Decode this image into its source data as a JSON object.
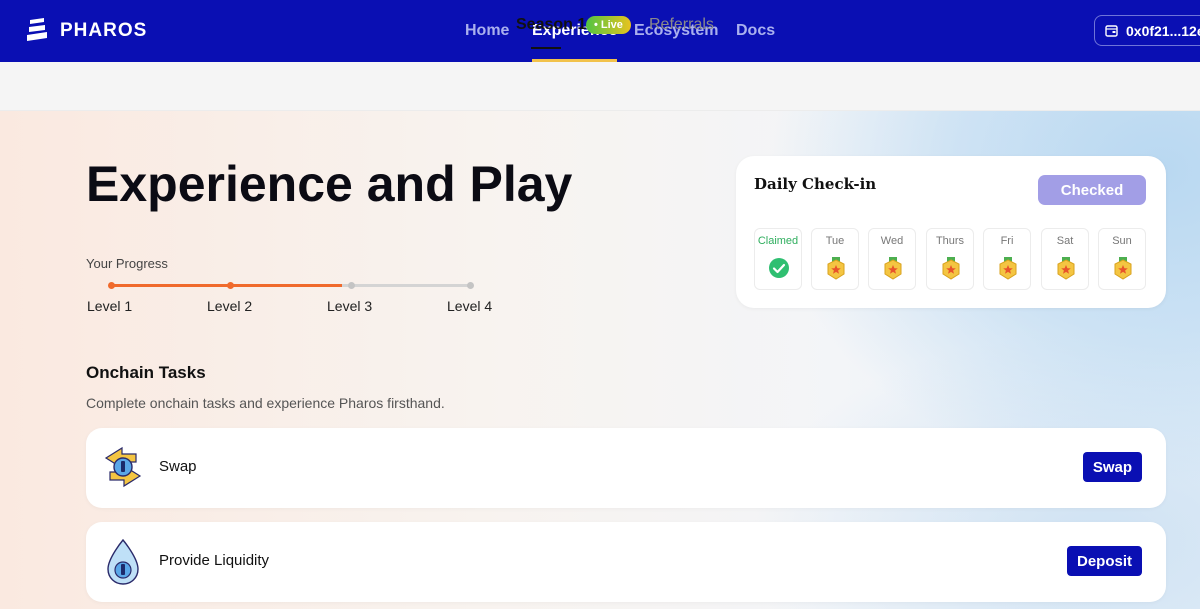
{
  "header": {
    "brand": "PHAROS",
    "nav": [
      {
        "label": "Home"
      },
      {
        "label": "Experience"
      },
      {
        "label": "Ecosystem"
      },
      {
        "label": "Docs"
      }
    ],
    "active_nav": "Experience",
    "wallet": "0x0f21...12e"
  },
  "subnav": {
    "season": "Season 1",
    "live_badge": "• Live",
    "referrals": "Referrals"
  },
  "hero": {
    "title": "Experience and Play",
    "progress_label": "Your Progress",
    "levels": [
      "Level 1",
      "Level 2",
      "Level 3",
      "Level 4"
    ],
    "progress_fraction": 0.64
  },
  "checkin": {
    "title": "Daily Check-in",
    "button": "Checked",
    "days": [
      {
        "label": "Claimed",
        "status": "claimed",
        "icon": "check-circle-icon"
      },
      {
        "label": "Tue",
        "status": "pending",
        "icon": "medal-icon"
      },
      {
        "label": "Wed",
        "status": "pending",
        "icon": "medal-icon"
      },
      {
        "label": "Thurs",
        "status": "pending",
        "icon": "medal-icon"
      },
      {
        "label": "Fri",
        "status": "pending",
        "icon": "medal-icon"
      },
      {
        "label": "Sat",
        "status": "pending",
        "icon": "medal-icon"
      },
      {
        "label": "Sun",
        "status": "pending",
        "icon": "medal-icon"
      }
    ]
  },
  "tasks": {
    "title": "Onchain Tasks",
    "subtitle": "Complete onchain tasks and experience Pharos firsthand.",
    "items": [
      {
        "label": "Swap",
        "button": "Swap",
        "icon": "swap-icon"
      },
      {
        "label": "Provide Liquidity",
        "button": "Deposit",
        "icon": "droplet-icon"
      }
    ]
  },
  "colors": {
    "primary": "#0a0fb3",
    "progress": "#f06a2c",
    "checked_button": "#a29ee6",
    "live_badge_start": "#52c443",
    "live_badge_end": "#e8c31e",
    "claimed": "#2fae5e"
  }
}
